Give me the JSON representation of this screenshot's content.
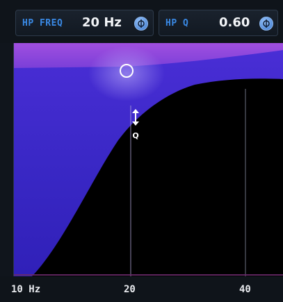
{
  "params": {
    "hp_freq": {
      "label": "HP FREQ",
      "value": "20 Hz"
    },
    "hp_q": {
      "label": "HP Q",
      "value": "0.60"
    }
  },
  "plot": {
    "q_handle_label": "Q"
  },
  "x_axis": {
    "ticks": [
      "10 Hz",
      "20",
      "40"
    ]
  },
  "colors": {
    "accent": "#3a8ae6",
    "fill_top": "#9a4ee0",
    "fill_bottom": "#3a28c8",
    "background": "#000000"
  }
}
